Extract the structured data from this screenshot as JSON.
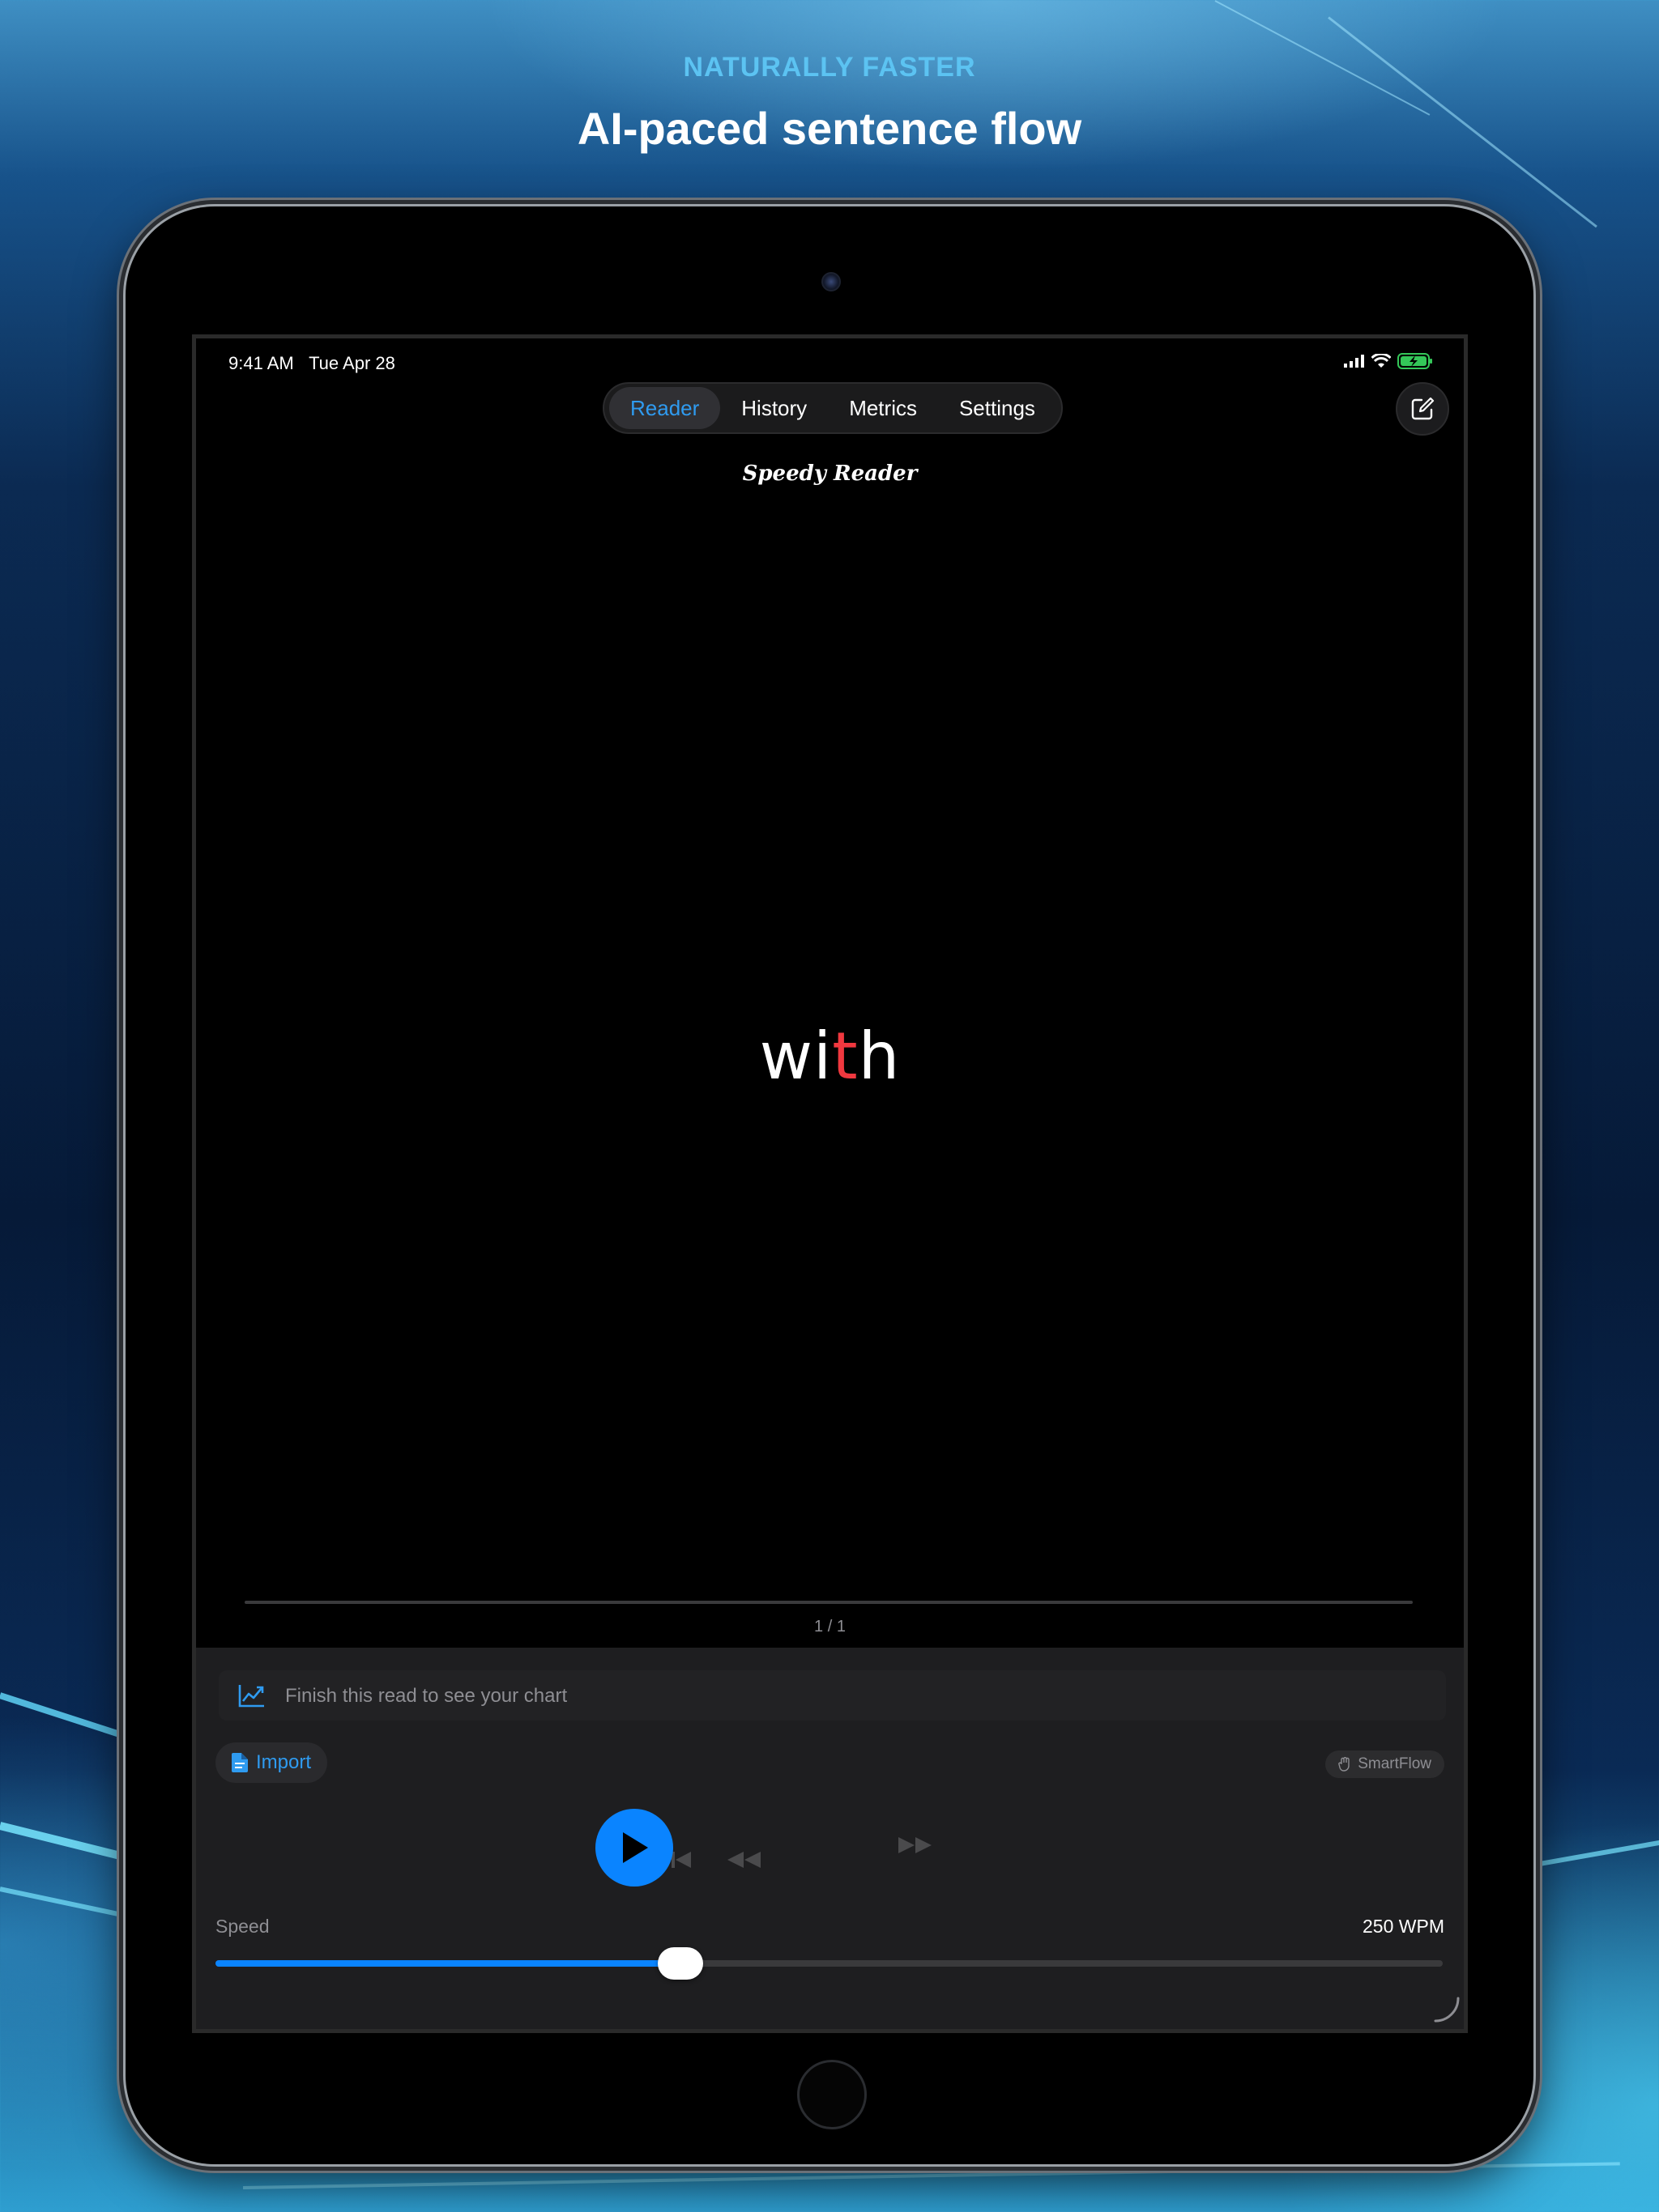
{
  "header": {
    "kicker": "NATURALLY FASTER",
    "title": "AI-paced sentence flow"
  },
  "status_bar": {
    "time": "9:41 AM",
    "date": "Tue Apr 28"
  },
  "nav": {
    "tabs": [
      {
        "label": "Reader",
        "active": true
      },
      {
        "label": "History",
        "active": false
      },
      {
        "label": "Metrics",
        "active": false
      },
      {
        "label": "Settings",
        "active": false
      }
    ]
  },
  "app_title": "Speedy Reader",
  "reader": {
    "word_pre": "wi",
    "word_focus": "t",
    "word_post": "h",
    "page_indicator": "1 / 1",
    "progress": 0
  },
  "chart_hint": "Finish this read to see your chart",
  "import_label": "Import",
  "smartflow_label": "SmartFlow",
  "speed": {
    "label": "Speed",
    "value_text": "250 WPM",
    "fraction": 0.379
  },
  "colors": {
    "accent": "#0a84ff",
    "focus_letter": "#f0383f",
    "kicker": "#5cc3f2"
  },
  "icons": [
    "compose-icon",
    "chart-icon",
    "document-icon",
    "hand-icon",
    "skip-start-icon",
    "rewind-icon",
    "play-icon",
    "fast-forward-icon",
    "resize-corner-icon",
    "signal-icon",
    "wifi-icon",
    "battery-icon"
  ]
}
